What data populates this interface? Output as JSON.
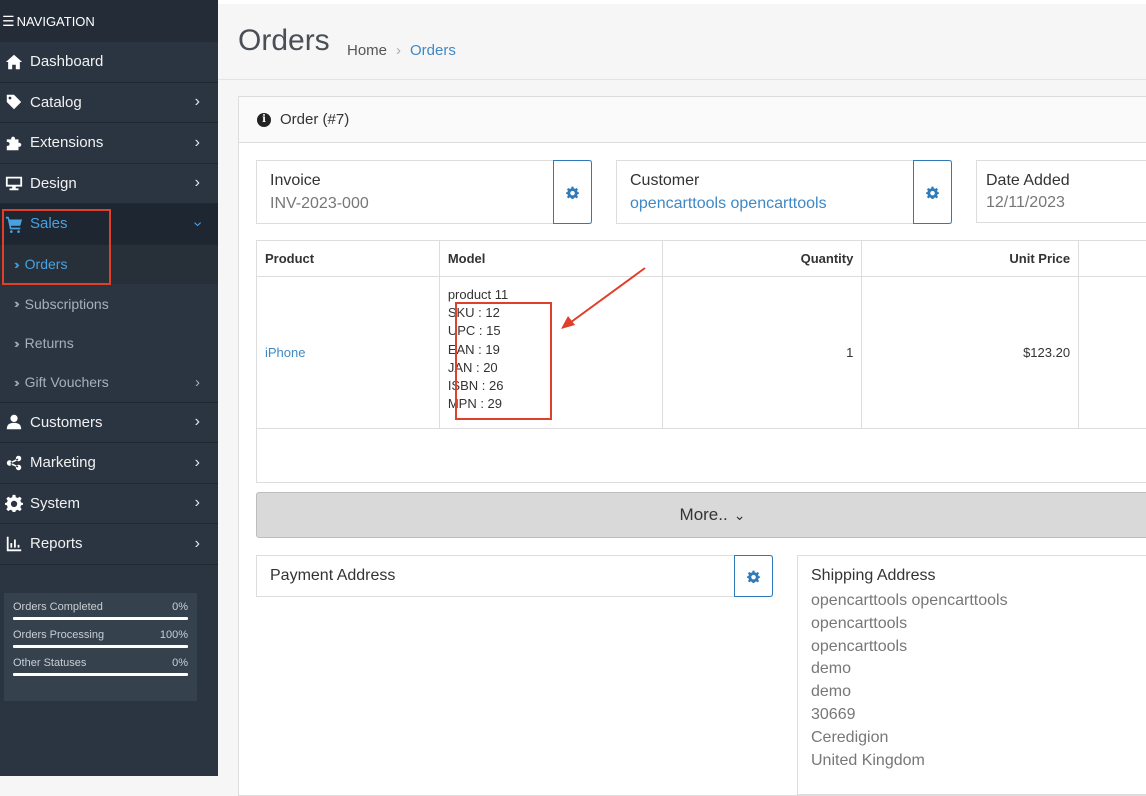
{
  "sidebar": {
    "title": "NAVIGATION",
    "menu": [
      {
        "label": "Dashboard",
        "icon": "home-icon"
      },
      {
        "label": "Catalog",
        "icon": "tag-icon"
      },
      {
        "label": "Extensions",
        "icon": "puzzle-icon"
      },
      {
        "label": "Design",
        "icon": "monitor-icon"
      },
      {
        "label": "Sales",
        "icon": "cart-icon"
      },
      {
        "label": "Customers",
        "icon": "user-icon"
      },
      {
        "label": "Marketing",
        "icon": "share-icon"
      },
      {
        "label": "System",
        "icon": "gear-icon"
      },
      {
        "label": "Reports",
        "icon": "bar-chart-icon"
      }
    ],
    "sales_sub": [
      "Orders",
      "Subscriptions",
      "Returns",
      "Gift Vouchers"
    ],
    "stats": [
      {
        "label": "Orders Completed",
        "value": "0%",
        "progress": 0
      },
      {
        "label": "Orders Processing",
        "value": "100%",
        "progress": 100
      },
      {
        "label": "Other Statuses",
        "value": "0%",
        "progress": 0
      }
    ]
  },
  "header": {
    "title": "Orders",
    "breadcrumb": [
      "Home",
      "Orders"
    ]
  },
  "panel": {
    "title": "Order (#7)"
  },
  "invoice": {
    "label": "Invoice",
    "value": "INV-2023-000"
  },
  "customer": {
    "label": "Customer",
    "value": "opencarttools opencarttools"
  },
  "date_added": {
    "label": "Date Added",
    "value": "12/11/2023"
  },
  "products_table": {
    "headers": [
      "Product",
      "Model",
      "Quantity",
      "Unit Price"
    ],
    "rows": [
      {
        "product": "iPhone",
        "model_lines": [
          "product 11",
          "SKU : 12",
          "UPC : 15",
          "EAN : 19",
          "JAN : 20",
          "ISBN : 26",
          "MPN : 29"
        ],
        "quantity": "1",
        "unit_price": "$123.20"
      }
    ]
  },
  "more_button": "More..",
  "payment_address": {
    "label": "Payment Address"
  },
  "shipping_address": {
    "label": "Shipping Address",
    "lines": [
      "opencarttools opencarttools",
      "opencarttools",
      "opencarttools",
      "demo",
      "demo",
      "30669",
      "Ceredigion",
      "United Kingdom"
    ]
  },
  "colors": {
    "sidebar_bg": "#2b3542",
    "accent": "#3f88c5",
    "annotation": "#e0402a"
  }
}
